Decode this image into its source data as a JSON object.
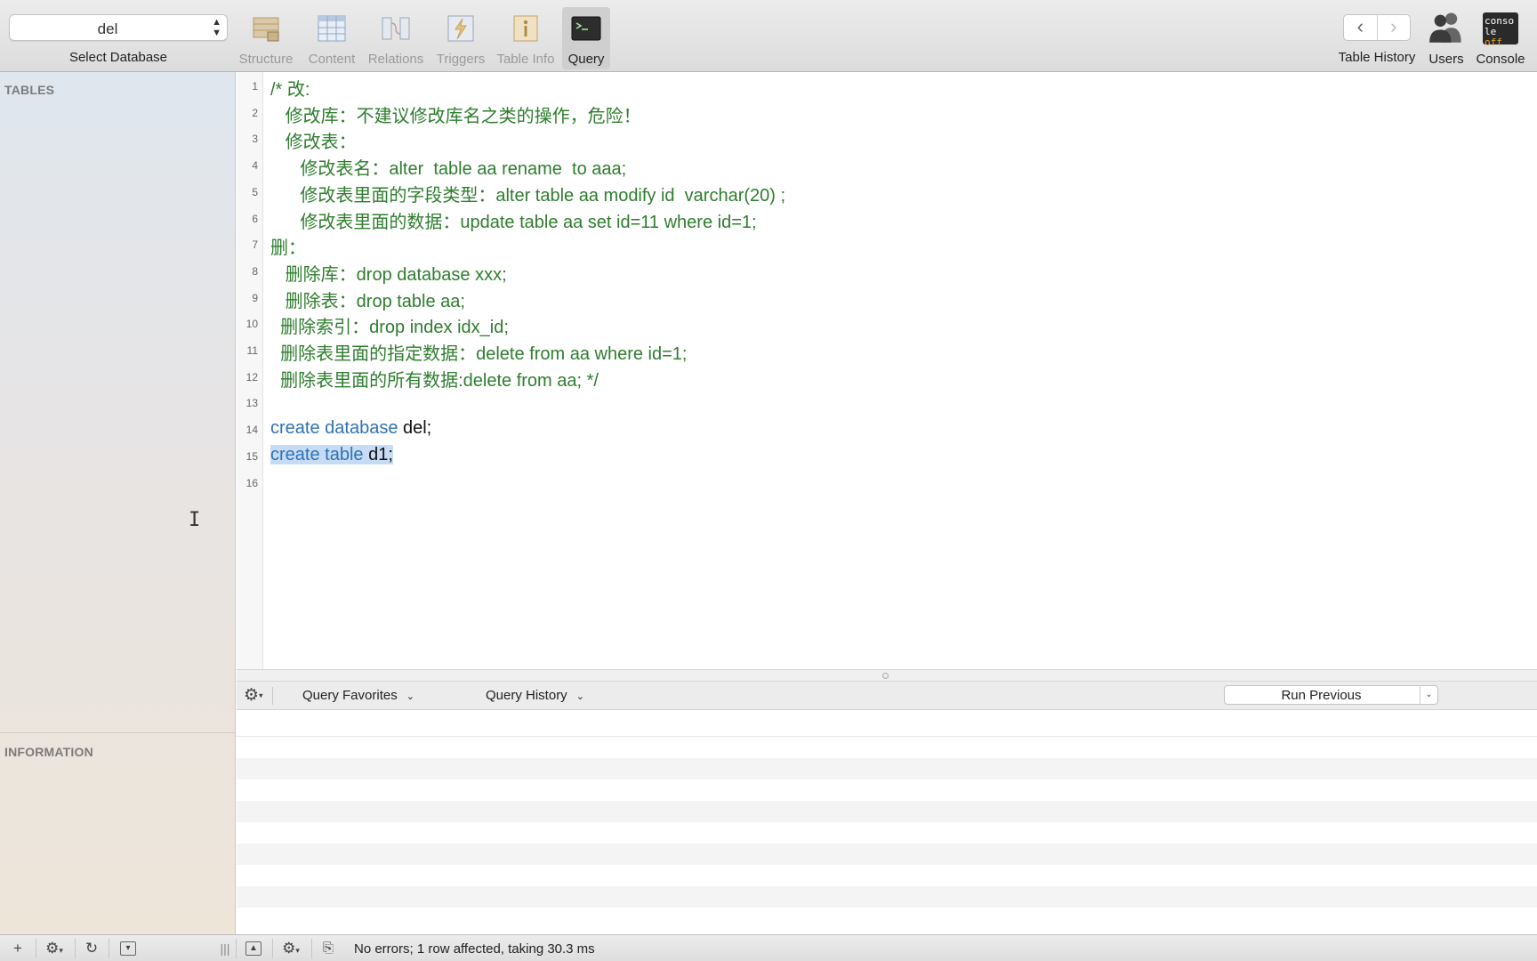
{
  "toolbar": {
    "database_select": {
      "value": "del",
      "label": "Select Database"
    },
    "items": [
      {
        "id": "structure",
        "label": "Structure"
      },
      {
        "id": "content",
        "label": "Content"
      },
      {
        "id": "relations",
        "label": "Relations"
      },
      {
        "id": "triggers",
        "label": "Triggers"
      },
      {
        "id": "table-info",
        "label": "Table Info"
      },
      {
        "id": "query",
        "label": "Query",
        "active": true
      }
    ],
    "right_items": [
      {
        "id": "table-history",
        "label": "Table History"
      },
      {
        "id": "users",
        "label": "Users"
      },
      {
        "id": "console",
        "label": "Console",
        "icon_text_1": "conso",
        "icon_text_2": "le",
        "icon_text_3": "off"
      }
    ],
    "nav": {
      "back": "‹",
      "forward": "›"
    }
  },
  "sidebar": {
    "tables_header": "TABLES",
    "information_header": "INFORMATION"
  },
  "editor": {
    "lines": [
      {
        "num": "1",
        "segments": [
          {
            "t": "/* 改:",
            "c": "comment"
          }
        ]
      },
      {
        "num": "2",
        "segments": [
          {
            "t": "   修改库：不建议修改库名之类的操作，危险！",
            "c": "comment"
          }
        ]
      },
      {
        "num": "3",
        "segments": [
          {
            "t": "   修改表：",
            "c": "comment"
          }
        ]
      },
      {
        "num": "4",
        "segments": [
          {
            "t": "      修改表名：alter  table aa rename  to aaa;",
            "c": "comment"
          }
        ]
      },
      {
        "num": "5",
        "segments": [
          {
            "t": "      修改表里面的字段类型：alter table aa modify id  varchar(20) ;",
            "c": "comment"
          }
        ]
      },
      {
        "num": "6",
        "segments": [
          {
            "t": "      修改表里面的数据：update table aa set id=11 where id=1;",
            "c": "comment"
          }
        ]
      },
      {
        "num": "7",
        "segments": [
          {
            "t": "删：",
            "c": "comment"
          }
        ]
      },
      {
        "num": "8",
        "segments": [
          {
            "t": "   删除库：drop database xxx;",
            "c": "comment"
          }
        ]
      },
      {
        "num": "9",
        "segments": [
          {
            "t": "   删除表：drop table aa;",
            "c": "comment"
          }
        ]
      },
      {
        "num": "10",
        "segments": [
          {
            "t": "  删除索引：drop index idx_id;",
            "c": "comment"
          }
        ]
      },
      {
        "num": "11",
        "segments": [
          {
            "t": "  删除表里面的指定数据：delete from aa where id=1;",
            "c": "comment"
          }
        ]
      },
      {
        "num": "12",
        "segments": [
          {
            "t": "  删除表里面的所有数据:delete from aa; */",
            "c": "comment"
          }
        ]
      },
      {
        "num": "13",
        "segments": []
      },
      {
        "num": "14",
        "segments": [
          {
            "t": "create database",
            "c": "kw"
          },
          {
            "t": " del;",
            "c": "plain"
          }
        ]
      },
      {
        "num": "15",
        "selected": true,
        "segments": [
          {
            "t": "create table",
            "c": "kw"
          },
          {
            "t": " d1;",
            "c": "plain"
          }
        ]
      },
      {
        "num": "16",
        "segments": []
      }
    ]
  },
  "query_bar": {
    "favorites_label": "Query Favorites",
    "history_label": "Query History",
    "run_previous_label": "Run Previous"
  },
  "status": {
    "message": "No errors; 1 row affected, taking 30.3 ms"
  }
}
